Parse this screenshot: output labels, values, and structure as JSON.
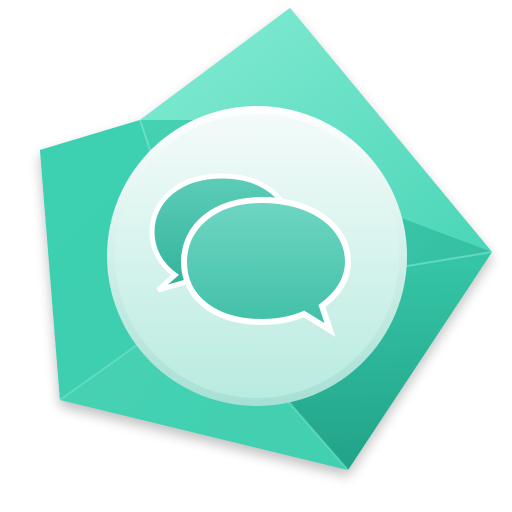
{
  "icon": {
    "name": "messages-app-icon",
    "glyph": "chat-bubbles-icon"
  },
  "colors": {
    "teal_light": "#8ff0d8",
    "teal_mid": "#4fd9bb",
    "teal_dark": "#2bb89a",
    "teal_shadow": "#1f9e84",
    "disc_top": "#f4fbfa",
    "disc_bottom": "#b9ebe0",
    "bubble_fill_top": "#6fd6c3",
    "bubble_fill_bottom": "#3fbfa6"
  }
}
